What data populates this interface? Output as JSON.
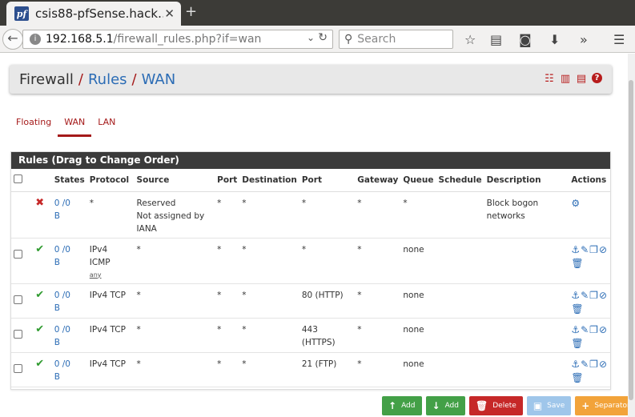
{
  "browser": {
    "tab_title": "csis88-pfSense.hack…",
    "tab_favicon": "pf",
    "url_host": "192.168.5.1",
    "url_path": "/firewall_rules.php?if=wan",
    "search_placeholder": "Search"
  },
  "breadcrumb": {
    "root": "Firewall",
    "rules": "Rules",
    "current": "WAN",
    "sep": "/"
  },
  "subtabs": [
    "Floating",
    "WAN",
    "LAN"
  ],
  "panel_title": "Rules (Drag to Change Order)",
  "columns": [
    "States",
    "Protocol",
    "Source",
    "Port",
    "Destination",
    "Port",
    "Gateway",
    "Queue",
    "Schedule",
    "Description",
    "Actions"
  ],
  "rows": [
    {
      "status": "block",
      "states": "0 /0",
      "states_unit": "B",
      "protocol": "*",
      "protocol_sub": "",
      "source": "Reserved\nNot assigned by\nIANA",
      "src_port": "*",
      "destination": "*",
      "dst_port": "*",
      "gateway": "*",
      "queue": "*",
      "schedule": "",
      "description": "Block bogon\nnetworks",
      "selectable": false
    },
    {
      "status": "pass",
      "states": "0 /0",
      "states_unit": "B",
      "protocol": "IPv4\nICMP",
      "protocol_sub": "any",
      "source": "*",
      "src_port": "*",
      "destination": "*",
      "dst_port": "*",
      "gateway": "*",
      "queue": "none",
      "schedule": "",
      "description": "",
      "selectable": true
    },
    {
      "status": "pass",
      "states": "0 /0",
      "states_unit": "B",
      "protocol": "IPv4 TCP",
      "protocol_sub": "",
      "source": "*",
      "src_port": "*",
      "destination": "*",
      "dst_port": "80 (HTTP)",
      "gateway": "*",
      "queue": "none",
      "schedule": "",
      "description": "",
      "selectable": true
    },
    {
      "status": "pass",
      "states": "0 /0",
      "states_unit": "B",
      "protocol": "IPv4 TCP",
      "protocol_sub": "",
      "source": "*",
      "src_port": "*",
      "destination": "*",
      "dst_port": "443\n(HTTPS)",
      "gateway": "*",
      "queue": "none",
      "schedule": "",
      "description": "",
      "selectable": true
    },
    {
      "status": "pass",
      "states": "0 /0",
      "states_unit": "B",
      "protocol": "IPv4 TCP",
      "protocol_sub": "",
      "source": "*",
      "src_port": "*",
      "destination": "*",
      "dst_port": "21 (FTP)",
      "gateway": "*",
      "queue": "none",
      "schedule": "",
      "description": "",
      "selectable": true
    }
  ],
  "buttons": {
    "add_top": "Add",
    "add_bottom": "Add",
    "delete": "Delete",
    "save": "Save",
    "separator": "Separator"
  },
  "colors": {
    "accent_red": "#a51a1a",
    "link_blue": "#2b6cb5",
    "pass_green": "#2e9a2e"
  }
}
